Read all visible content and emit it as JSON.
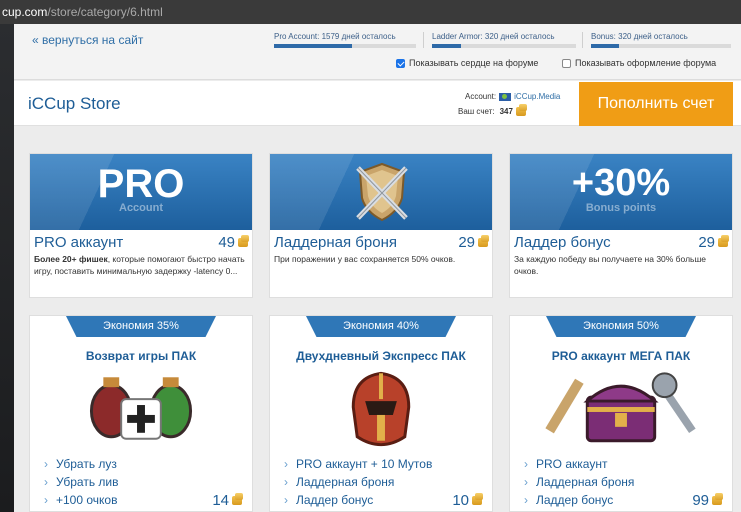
{
  "browser": {
    "url_host": "cup.com",
    "url_path": "/store/category/6.html"
  },
  "topbar": {
    "back_link": "« вернуться на сайт",
    "stats": [
      {
        "label": "Pro Account: 1579 дней осталось",
        "fill": 0.55
      },
      {
        "label": "Ladder Armor: 320 дней осталось",
        "fill": 0.2
      },
      {
        "label": "Bonus: 320 дней осталось",
        "fill": 0.2
      }
    ],
    "checkbox_heart": {
      "label": "Показывать сердце на форуме",
      "checked": true
    },
    "checkbox_design": {
      "label": "Показывать оформление форума",
      "checked": false
    }
  },
  "store": {
    "title": "iCCup Store",
    "account_label": "Account:",
    "account_name": "iCCup.Media",
    "balance_label": "Ваш счет:",
    "balance_value": "347",
    "topup_button": "Пополнить счет"
  },
  "products": [
    {
      "banner_big": "PRO",
      "banner_small": "Account",
      "name": "PRO аккаунт",
      "price": "49",
      "desc_bold": "Более 20+ фишек",
      "desc": ", которые помогают быстро начать игру, поставить минимальную задержку -latency 0..."
    },
    {
      "banner_big": "",
      "banner_small": "",
      "name": "Ладдерная броня",
      "price": "29",
      "desc_bold": "",
      "desc": "При поражении у вас сохраняется 50% очков."
    },
    {
      "banner_big": "+30%",
      "banner_small": "Bonus points",
      "name": "Ладдер бонус",
      "price": "29",
      "desc_bold": "",
      "desc": "За каждую победу вы получаете на 30% больше очков."
    }
  ],
  "packs": [
    {
      "ribbon": "Экономия 35%",
      "title": "Возврат игры ПАК",
      "items": [
        "Убрать луз",
        "Убрать лив",
        "+100 очков"
      ],
      "price": "14"
    },
    {
      "ribbon": "Экономия 40%",
      "title": "Двухдневный Экспресс ПАК",
      "items": [
        "PRO аккаунт + 10 Мутов",
        "Ладдерная броня",
        "Ладдер бонус"
      ],
      "price": "10"
    },
    {
      "ribbon": "Экономия 50%",
      "title": "PRO аккаунт МЕГА ПАК",
      "items": [
        "PRO аккаунт",
        "Ладдерная броня",
        "Ладдер бонус"
      ],
      "price": "99"
    }
  ],
  "colors": {
    "brand_blue": "#1e5d96",
    "banner_blue": "#2e6aa8",
    "topup_orange": "#f09d15"
  }
}
